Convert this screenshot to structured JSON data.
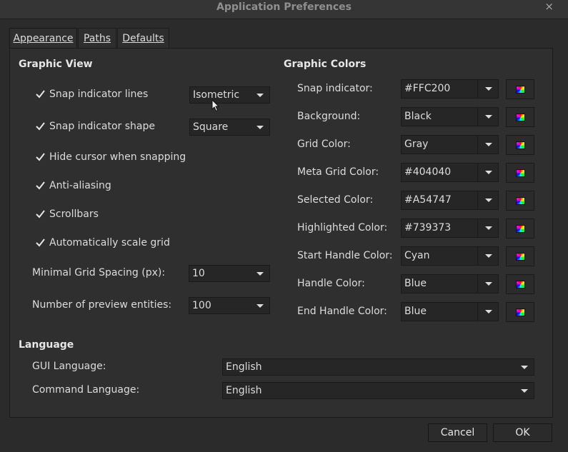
{
  "window": {
    "title": "Application Preferences",
    "close_glyph": "×"
  },
  "tabs": [
    {
      "label": "Appearance",
      "active": true
    },
    {
      "label": "Paths",
      "active": false
    },
    {
      "label": "Defaults",
      "active": false
    }
  ],
  "graphic_view": {
    "heading": "Graphic View",
    "snap_lines": {
      "label": "Snap indicator lines",
      "checked": true,
      "value": "Isometric"
    },
    "snap_shape": {
      "label": "Snap indicator shape",
      "checked": true,
      "value": "Square"
    },
    "hide_cursor": {
      "label": "Hide cursor when snapping",
      "checked": true
    },
    "anti_aliasing": {
      "label": "Anti-aliasing",
      "checked": true
    },
    "scrollbars": {
      "label": "Scrollbars",
      "checked": true
    },
    "auto_scale": {
      "label": "Automatically scale grid",
      "checked": true
    },
    "min_grid": {
      "label": "Minimal Grid Spacing (px):",
      "value": "10"
    },
    "preview": {
      "label": "Number of preview entities:",
      "value": "100"
    }
  },
  "graphic_colors": {
    "heading": "Graphic Colors",
    "rows": [
      {
        "label": "Snap indicator:",
        "value": "#FFC200"
      },
      {
        "label": "Background:",
        "value": "Black"
      },
      {
        "label": "Grid Color:",
        "value": "Gray"
      },
      {
        "label": "Meta Grid Color:",
        "value": "#404040"
      },
      {
        "label": "Selected Color:",
        "value": "#A54747"
      },
      {
        "label": "Highlighted Color:",
        "value": "#739373"
      },
      {
        "label": "Start Handle Color:",
        "value": "Cyan"
      },
      {
        "label": "Handle Color:",
        "value": "Blue"
      },
      {
        "label": "End Handle Color:",
        "value": "Blue"
      }
    ]
  },
  "language": {
    "heading": "Language",
    "gui": {
      "label": "GUI Language:",
      "value": "English"
    },
    "command": {
      "label": "Command Language:",
      "value": "English"
    }
  },
  "buttons": {
    "cancel": "Cancel",
    "ok": "OK"
  },
  "icons": {
    "checkbox": "check-icon",
    "dropdown": "chevron-down-icon",
    "color_picker": "color-palette-icon",
    "cursor": "mouse-pointer-icon"
  }
}
